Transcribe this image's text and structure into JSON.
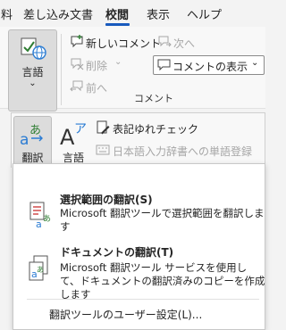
{
  "tabs": [
    {
      "label": "料"
    },
    {
      "label": "差し込み文書"
    },
    {
      "label": "校閲",
      "active": true
    },
    {
      "label": "表示"
    },
    {
      "label": "ヘルプ"
    }
  ],
  "ribbon": {
    "language_button": {
      "label": "言語",
      "chevron": "⌄"
    },
    "comment_group": {
      "new_comment": "新しいコメント",
      "next": "次へ",
      "delete": "削除",
      "delete_chevron": "⌄",
      "previous": "前へ",
      "show_comments": "コメントの表示",
      "show_chevron": "⌄",
      "group_label": "コメント"
    }
  },
  "translate_panel": {
    "translate_button": {
      "label": "翻訳",
      "chevron": "⌄"
    },
    "language_button": {
      "label": "言語",
      "chevron": "⌄"
    },
    "spell_variant": "表記ゆれチェック",
    "dictionary": "日本語入力辞書への単語登録"
  },
  "menu": {
    "items": [
      {
        "title": "選択範囲の翻訳(S)",
        "desc": "Microsoft 翻訳ツールで選択範囲を翻訳します"
      },
      {
        "title": "ドキュメントの翻訳(T)",
        "desc": "Microsoft 翻訳ツール サービスを使用して、ドキュメントの翻訳済みのコピーを作成します"
      }
    ],
    "settings": "翻訳ツールのユーザー設定(L)..."
  },
  "colors": {
    "accent": "#185abd",
    "green": "#2e7d32",
    "icon_blue": "#2b7cd3",
    "disabled": "#a6a6a6"
  }
}
